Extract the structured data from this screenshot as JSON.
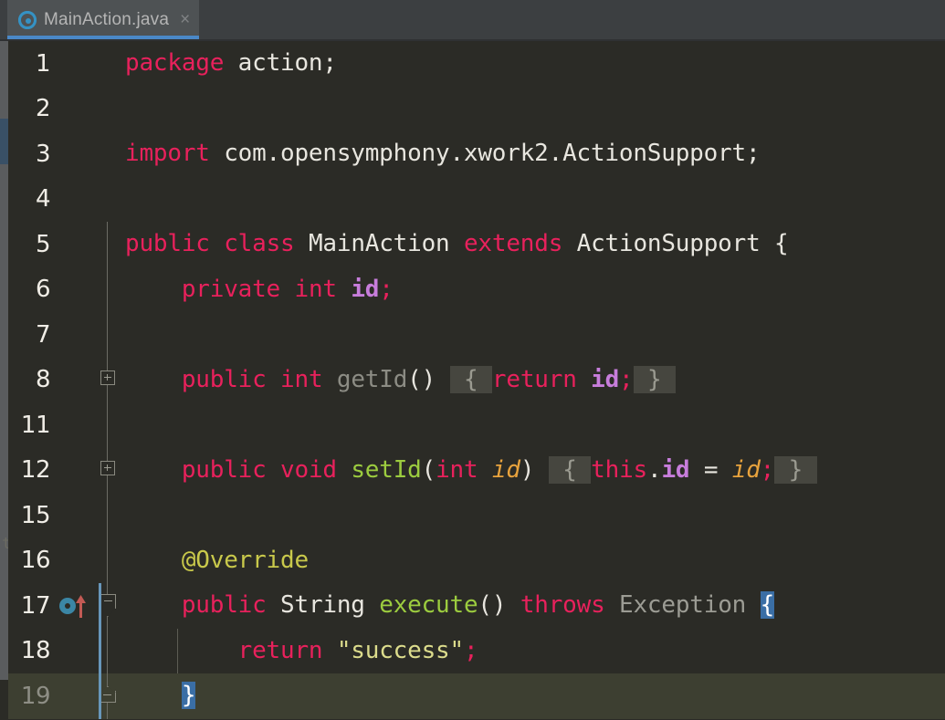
{
  "window": {
    "app": "IntelliJ IDEA Editor",
    "accent_color": "#4a88c7",
    "editor_background": "#2b2b26",
    "caret_line_background": "#3d3f31"
  },
  "tabbar": {
    "background": "#3c3f41",
    "tabs": [
      {
        "label": "MainAction.java",
        "icon": "java-class-icon",
        "icon_letter": "C",
        "icon_color": "#3592c4",
        "active": true,
        "close_label": "×",
        "underline_color": "#4a88c7"
      }
    ]
  },
  "editor": {
    "language": "Java",
    "left_rail_ghost_text": "t",
    "lines": [
      {
        "number": "1",
        "fold": "none",
        "gutter_icon": null,
        "caret_line": false,
        "indent_guide": false,
        "change_bar": false,
        "tokens": [
          {
            "t": "package",
            "c": "kw"
          },
          {
            "t": " ",
            "c": "plain"
          },
          {
            "t": "action",
            "c": "plain"
          },
          {
            "t": ";",
            "c": "plain"
          }
        ]
      },
      {
        "number": "2",
        "fold": "none",
        "gutter_icon": null,
        "caret_line": false,
        "indent_guide": false,
        "change_bar": false,
        "tokens": []
      },
      {
        "number": "3",
        "fold": "none",
        "gutter_icon": null,
        "caret_line": false,
        "indent_guide": false,
        "change_bar": false,
        "tokens": [
          {
            "t": "import",
            "c": "kw"
          },
          {
            "t": " com.opensymphony.xwork2.ActionSupport;",
            "c": "plain"
          }
        ]
      },
      {
        "number": "4",
        "fold": "none",
        "gutter_icon": null,
        "caret_line": false,
        "indent_guide": false,
        "change_bar": false,
        "tokens": []
      },
      {
        "number": "5",
        "fold": "line",
        "gutter_icon": null,
        "caret_line": false,
        "indent_guide": false,
        "change_bar": false,
        "tokens": [
          {
            "t": "public",
            "c": "kw"
          },
          {
            "t": " ",
            "c": "plain"
          },
          {
            "t": "class",
            "c": "kw"
          },
          {
            "t": " ",
            "c": "plain"
          },
          {
            "t": "MainAction",
            "c": "type"
          },
          {
            "t": " ",
            "c": "plain"
          },
          {
            "t": "extends",
            "c": "kw"
          },
          {
            "t": " ",
            "c": "plain"
          },
          {
            "t": "ActionSupport",
            "c": "type"
          },
          {
            "t": " {",
            "c": "plain"
          }
        ]
      },
      {
        "number": "6",
        "fold": "line",
        "gutter_icon": null,
        "caret_line": false,
        "indent_guide": false,
        "change_bar": false,
        "tokens": [
          {
            "t": "    ",
            "c": "plain"
          },
          {
            "t": "private",
            "c": "kw"
          },
          {
            "t": " ",
            "c": "plain"
          },
          {
            "t": "int",
            "c": "kw"
          },
          {
            "t": " ",
            "c": "plain"
          },
          {
            "t": "id",
            "c": "field"
          },
          {
            "t": ";",
            "c": "semi"
          }
        ]
      },
      {
        "number": "7",
        "fold": "line",
        "gutter_icon": null,
        "caret_line": false,
        "indent_guide": false,
        "change_bar": false,
        "tokens": []
      },
      {
        "number": "8",
        "fold": "plus",
        "gutter_icon": null,
        "caret_line": false,
        "indent_guide": false,
        "change_bar": false,
        "tokens": [
          {
            "t": "    ",
            "c": "plain"
          },
          {
            "t": "public",
            "c": "kw"
          },
          {
            "t": " ",
            "c": "plain"
          },
          {
            "t": "int",
            "c": "kw"
          },
          {
            "t": " ",
            "c": "plain"
          },
          {
            "t": "getId",
            "c": "methodg"
          },
          {
            "t": "()",
            "c": "paren"
          },
          {
            "t": " ",
            "c": "plain"
          },
          {
            "t": " { ",
            "c": "folded"
          },
          {
            "t": "return",
            "c": "kw"
          },
          {
            "t": " ",
            "c": "plain"
          },
          {
            "t": "id",
            "c": "field"
          },
          {
            "t": ";",
            "c": "semi"
          },
          {
            "t": " } ",
            "c": "folded"
          }
        ]
      },
      {
        "number": "11",
        "fold": "line",
        "gutter_icon": null,
        "caret_line": false,
        "indent_guide": false,
        "change_bar": false,
        "tokens": []
      },
      {
        "number": "12",
        "fold": "plus",
        "gutter_icon": null,
        "caret_line": false,
        "indent_guide": false,
        "change_bar": false,
        "tokens": [
          {
            "t": "    ",
            "c": "plain"
          },
          {
            "t": "public",
            "c": "kw"
          },
          {
            "t": " ",
            "c": "plain"
          },
          {
            "t": "void",
            "c": "kw"
          },
          {
            "t": " ",
            "c": "plain"
          },
          {
            "t": "setId",
            "c": "method"
          },
          {
            "t": "(",
            "c": "paren"
          },
          {
            "t": "int",
            "c": "kw"
          },
          {
            "t": " ",
            "c": "plain"
          },
          {
            "t": "id",
            "c": "param"
          },
          {
            "t": ")",
            "c": "paren"
          },
          {
            "t": " ",
            "c": "plain"
          },
          {
            "t": " { ",
            "c": "folded"
          },
          {
            "t": "this",
            "c": "kw"
          },
          {
            "t": ".",
            "c": "punct"
          },
          {
            "t": "id",
            "c": "field"
          },
          {
            "t": " = ",
            "c": "plain"
          },
          {
            "t": "id",
            "c": "param"
          },
          {
            "t": ";",
            "c": "semi"
          },
          {
            "t": " } ",
            "c": "folded"
          }
        ]
      },
      {
        "number": "15",
        "fold": "line",
        "gutter_icon": null,
        "caret_line": false,
        "indent_guide": false,
        "change_bar": false,
        "tokens": []
      },
      {
        "number": "16",
        "fold": "line",
        "gutter_icon": null,
        "caret_line": false,
        "indent_guide": false,
        "change_bar": false,
        "tokens": [
          {
            "t": "    ",
            "c": "plain"
          },
          {
            "t": "@Override",
            "c": "anno"
          }
        ]
      },
      {
        "number": "17",
        "fold": "minus-down",
        "gutter_icon": "overriding-method-icon",
        "caret_line": false,
        "indent_guide": false,
        "change_bar": true,
        "tokens": [
          {
            "t": "    ",
            "c": "plain"
          },
          {
            "t": "public",
            "c": "kw"
          },
          {
            "t": " ",
            "c": "plain"
          },
          {
            "t": "String",
            "c": "type"
          },
          {
            "t": " ",
            "c": "plain"
          },
          {
            "t": "execute",
            "c": "method"
          },
          {
            "t": "()",
            "c": "paren"
          },
          {
            "t": " ",
            "c": "plain"
          },
          {
            "t": "throws",
            "c": "kw"
          },
          {
            "t": " ",
            "c": "plain"
          },
          {
            "t": "Exception",
            "c": "typed"
          },
          {
            "t": " ",
            "c": "plain"
          },
          {
            "t": "{",
            "c": "brace-hl"
          }
        ]
      },
      {
        "number": "18",
        "fold": "line",
        "gutter_icon": null,
        "caret_line": false,
        "indent_guide": true,
        "change_bar": true,
        "tokens": [
          {
            "t": "        ",
            "c": "plain"
          },
          {
            "t": "return",
            "c": "kw"
          },
          {
            "t": " ",
            "c": "plain"
          },
          {
            "t": "\"success\"",
            "c": "str"
          },
          {
            "t": ";",
            "c": "semi"
          }
        ]
      },
      {
        "number": "19",
        "fold": "minus-up",
        "gutter_icon": null,
        "caret_line": true,
        "indent_guide": false,
        "change_bar": true,
        "tokens": [
          {
            "t": "    ",
            "c": "plain"
          },
          {
            "t": "}",
            "c": "brace-hl"
          }
        ]
      }
    ]
  }
}
